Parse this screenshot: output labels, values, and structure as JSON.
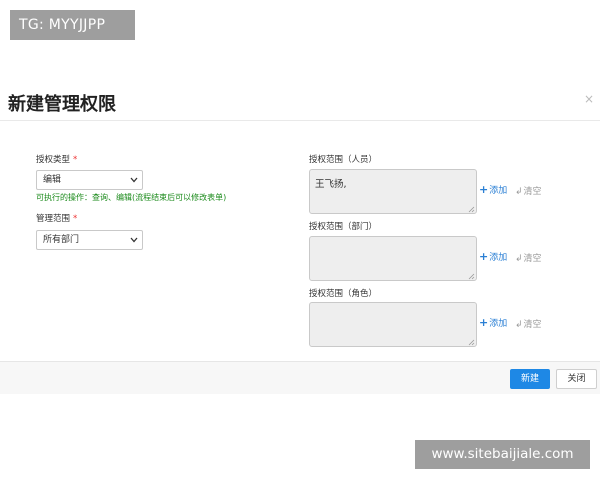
{
  "watermarks": {
    "top": "TG: MYYJJPP",
    "bottom": "www.sitebaijiale.com"
  },
  "dialog": {
    "title": "新建管理权限",
    "close_glyph": "×"
  },
  "left": {
    "auth_type": {
      "label": "授权类型",
      "required": "*",
      "value": "编辑"
    },
    "hint": "可执行的操作：查询、编辑(流程结束后可以修改表单)",
    "scope": {
      "label": "管理范围",
      "required": "*",
      "value": "所有部门"
    }
  },
  "right": {
    "add_label": "添加",
    "clear_label": "清空",
    "groups": [
      {
        "label": "授权范围（人员）",
        "value": "王飞扬,"
      },
      {
        "label": "授权范围（部门）",
        "value": ""
      },
      {
        "label": "授权范围（角色）",
        "value": ""
      }
    ]
  },
  "footer": {
    "create_label": "新建",
    "close_label": "关闭"
  },
  "colors": {
    "primary": "#1e88e5",
    "hint_green": "#1a8a1a",
    "required_red": "#e33333",
    "link_blue": "#2a7fd4"
  }
}
